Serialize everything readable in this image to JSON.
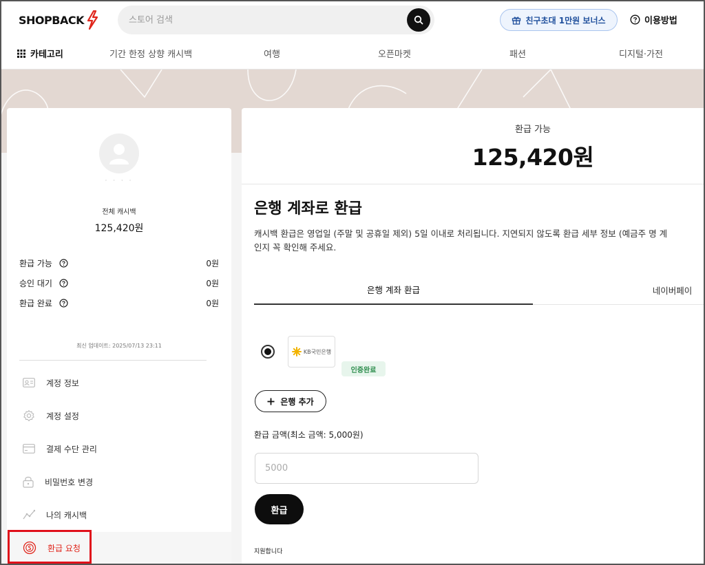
{
  "header": {
    "logo_text": "SHOPBACK",
    "search_placeholder": "스토어 검색",
    "invite_label": "친구초대 1만원 보너스",
    "howto_label": "이용방법"
  },
  "nav": {
    "category_label": "카테고리",
    "items": [
      {
        "label": "기간 한정 상향 캐시백"
      },
      {
        "label": "여행"
      },
      {
        "label": "오픈마켓"
      },
      {
        "label": "패션"
      },
      {
        "label": "디지털·가전"
      }
    ]
  },
  "sidebar": {
    "user_name_masked": "· · · ·",
    "total_cashback_label": "전체 캐시백",
    "total_cashback_value": "125,420원",
    "stats": [
      {
        "label": "환급 가능",
        "value": "0원"
      },
      {
        "label": "승인 대기",
        "value": "0원"
      },
      {
        "label": "환급 완료",
        "value": "0원"
      }
    ],
    "updated": "최신 업데이트: 2025/07/13 23:11",
    "menu": [
      {
        "label": "계정 정보",
        "icon": "id-card-icon"
      },
      {
        "label": "계정 설정",
        "icon": "gear-icon"
      },
      {
        "label": "결제 수단 관리",
        "icon": "credit-card-icon"
      },
      {
        "label": "비밀번호 변경",
        "icon": "lock-icon"
      },
      {
        "label": "나의 캐시백",
        "icon": "trend-chart-icon"
      },
      {
        "label": "환급 요청",
        "icon": "refund-coin-icon",
        "active": true
      }
    ]
  },
  "main": {
    "available_label": "환급 가능",
    "available_value": "125,420원",
    "title": "은행 계좌로 환급",
    "description_line1": "캐시백 환급은 영업일 (주말 및 공휴일 제외) 5일 이내로 처리됩니다. 지연되지 않도록 환급 세부 정보 (예금주 명 계",
    "description_line2": "인지 꼭 확인해 주세요.",
    "tabs": [
      {
        "label": "은행 계좌 환급",
        "active": true
      },
      {
        "label": "네이버페이",
        "active": false
      }
    ],
    "bank_name": "KB국민은행",
    "verified_badge": "인증완료",
    "add_bank_label": "은행 추가",
    "amount_label": "환급 금액(최소 금액: 5,000원)",
    "amount_placeholder": "5000",
    "refund_button": "환급",
    "support_text": "지원합니다"
  },
  "colors": {
    "accent_red": "#e0261c",
    "banner": "#e3d8d2",
    "verified_green": "#2b8c4b"
  }
}
